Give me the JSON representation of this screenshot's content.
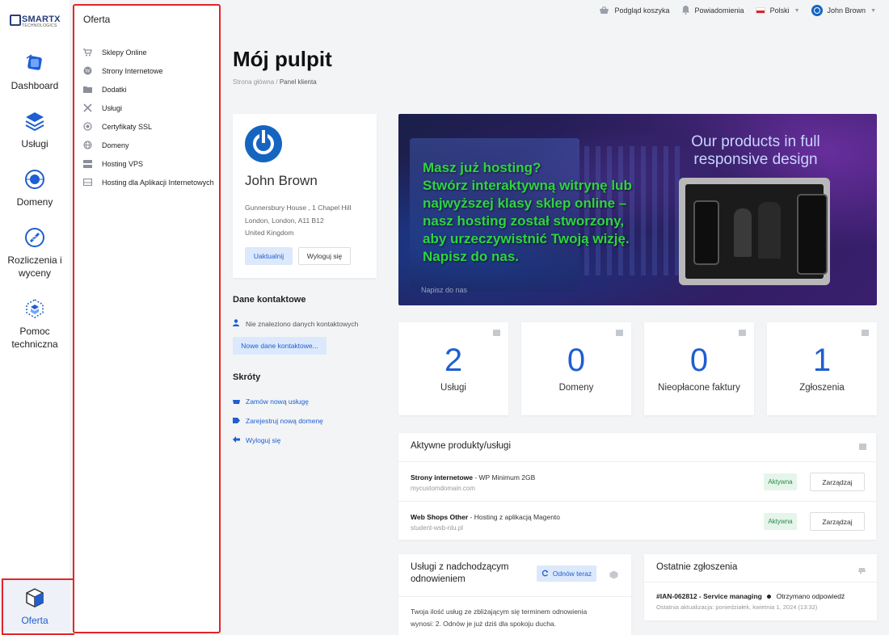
{
  "logo": {
    "line1": "SMARTX",
    "line2": "TECHNOLOGICS"
  },
  "rail": {
    "items": [
      {
        "label": "Dashboard"
      },
      {
        "label": "Usługi"
      },
      {
        "label": "Domeny"
      },
      {
        "label": "Rozliczenia i wyceny"
      },
      {
        "label": "Pomoc techniczna"
      },
      {
        "label": "Oferta"
      }
    ]
  },
  "offer_menu": {
    "title": "Oferta",
    "items": [
      {
        "label": "Sklepy Online",
        "icon": "cart-icon"
      },
      {
        "label": "Strony Internetowe",
        "icon": "wordpress-icon"
      },
      {
        "label": "Dodatki",
        "icon": "folder-plus-icon"
      },
      {
        "label": "Usługi",
        "icon": "tools-icon"
      },
      {
        "label": "Certyfikaty SSL",
        "icon": "certificate-icon"
      },
      {
        "label": "Domeny",
        "icon": "globe-icon"
      },
      {
        "label": "Hosting VPS",
        "icon": "server-icon"
      },
      {
        "label": "Hosting dla Aplikacji Internetowych",
        "icon": "hdd-icon"
      }
    ]
  },
  "topbar": {
    "cart": "Podgląd koszyka",
    "notifications": "Powiadomienia",
    "language": "Polski",
    "user": "John Brown"
  },
  "page": {
    "title": "Mój pulpit",
    "breadcrumb_home": "Strona główna",
    "breadcrumb_current": "Panel klienta"
  },
  "profile": {
    "name": "John Brown",
    "address_1": "Gunnersbury House , 1 Chapel Hill",
    "address_2": "London, London, A11 B12",
    "address_3": "United Kingdom",
    "update_label": "Uaktualnij",
    "logout_label": "Wyloguj się"
  },
  "contacts": {
    "title": "Dane kontaktowe",
    "empty": "Nie znaleziono danych kontaktowych",
    "new_label": "Nowe dane kontaktowe..."
  },
  "shortcuts": {
    "title": "Skróty",
    "items": [
      {
        "label": "Zamów nową usługę"
      },
      {
        "label": "Zarejestruj nową domenę"
      },
      {
        "label": "Wyloguj się"
      }
    ]
  },
  "banner": {
    "headline": "Our products in full responsive design",
    "lines": [
      "Masz już hosting?",
      "Stwórz interaktywną witrynę lub",
      "najwyższej klasy sklep online –",
      "nasz hosting został stworzony,",
      "aby urzeczywistnić Twoją wizję.",
      "Napisz do nas."
    ],
    "cta": "Napisz do nas"
  },
  "stats": [
    {
      "value": "2",
      "label": "Usługi"
    },
    {
      "value": "0",
      "label": "Domeny"
    },
    {
      "value": "0",
      "label": "Nieopłacone faktury"
    },
    {
      "value": "1",
      "label": "Zgłoszenia"
    }
  ],
  "active_products": {
    "title": "Aktywne produkty/usługi",
    "rows": [
      {
        "name": "Strony internetowe",
        "plan": " - WP Minimum 2GB",
        "domain": "mycustomdomain.com",
        "status": "Aktywna",
        "action": "Zarządzaj"
      },
      {
        "name": "Web Shops Other",
        "plan": " - Hosting z aplikacją Magento",
        "domain": "student-wsb-nlu.pl",
        "status": "Aktywna",
        "action": "Zarządzaj"
      }
    ]
  },
  "renewals": {
    "title": "Usługi z nadchodzącym odnowieniem",
    "renew_label": "Odnów teraz",
    "body": "Twoja ilość usług ze zbliżającym się terminem odnowienia wynosi: 2. Odnów je już dziś dla spokoju ducha."
  },
  "tickets": {
    "title": "Ostatnie zgłoszenia",
    "item_title": "#IAN-062812 - Service managing",
    "item_status": "Otrzymano odpowiedź",
    "item_updated": "Ostatnia aktualizacja: poniedziałek, kwietnia 1, 2024 (13:32)"
  },
  "colors": {
    "accent": "#1e5fd1",
    "highlight_border": "#e0262b",
    "banner_text": "#2fd43f"
  }
}
